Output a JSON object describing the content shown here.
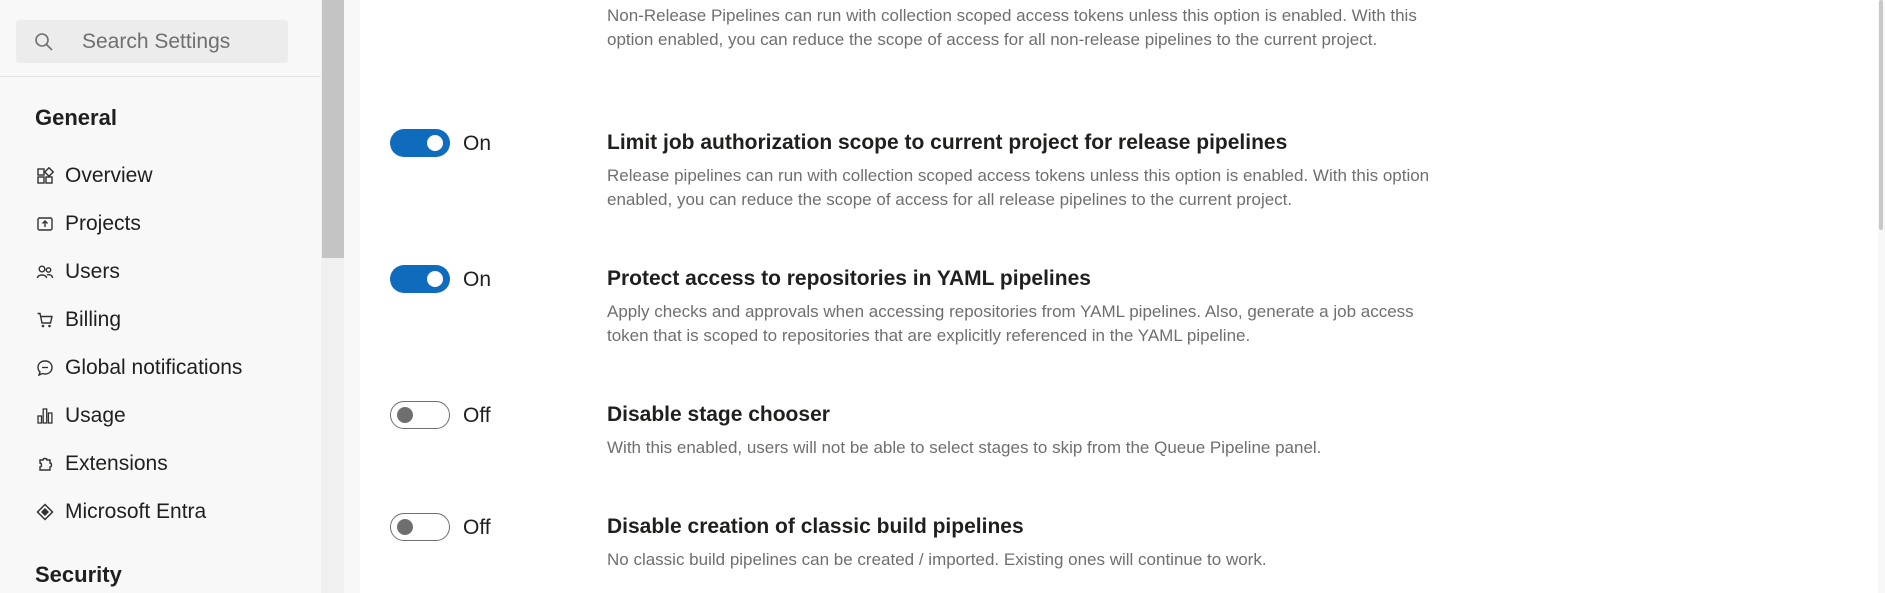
{
  "search": {
    "placeholder": "Search Settings"
  },
  "sidebar": {
    "general_heading": "General",
    "items": [
      {
        "label": "Overview",
        "icon": "overview-icon"
      },
      {
        "label": "Projects",
        "icon": "projects-icon"
      },
      {
        "label": "Users",
        "icon": "users-icon"
      },
      {
        "label": "Billing",
        "icon": "cart-icon"
      },
      {
        "label": "Global notifications",
        "icon": "notifications-icon"
      },
      {
        "label": "Usage",
        "icon": "usage-icon"
      },
      {
        "label": "Extensions",
        "icon": "extensions-icon"
      },
      {
        "label": "Microsoft Entra",
        "icon": "entra-icon"
      }
    ],
    "security_heading": "Security"
  },
  "settings": [
    {
      "title": "",
      "description": "Non-Release Pipelines can run with collection scoped access tokens unless this option is enabled. With this option enabled, you can reduce the scope of access for all non-release pipelines to the current project."
    },
    {
      "state": "On",
      "title": "Limit job authorization scope to current project for release pipelines",
      "description": "Release pipelines can run with collection scoped access tokens unless this option is enabled. With this option enabled, you can reduce the scope of access for all release pipelines to the current project."
    },
    {
      "state": "On",
      "title": "Protect access to repositories in YAML pipelines",
      "description": "Apply checks and approvals when accessing repositories from YAML pipelines. Also, generate a job access token that is scoped to repositories that are explicitly referenced in the YAML pipeline."
    },
    {
      "state": "Off",
      "title": "Disable stage chooser",
      "description": "With this enabled, users will not be able to select stages to skip from the Queue Pipeline panel."
    },
    {
      "state": "Off",
      "title": "Disable creation of classic build pipelines",
      "description": "No classic build pipelines can be created / imported. Existing ones will continue to work."
    }
  ],
  "colors": {
    "accent": "#0f6cbd",
    "muted_text": "#6f6f6f"
  }
}
